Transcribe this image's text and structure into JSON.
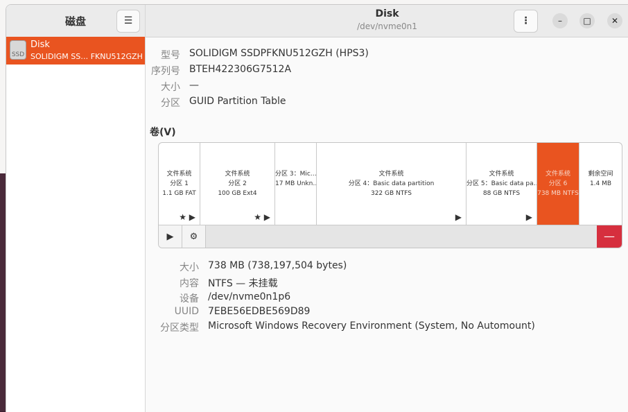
{
  "sidebar": {
    "title": "磁盘",
    "drive": {
      "icon_label": "SSD",
      "name": "Disk",
      "desc": "SOLIDIGM SS… FKNU512GZH"
    }
  },
  "header": {
    "title": "Disk",
    "subtitle": "/dev/nvme0n1",
    "menu_glyph": "⋮",
    "sidebar_menu_glyph": "☰",
    "min_glyph": "–",
    "max_glyph": "□",
    "close_glyph": "✕"
  },
  "disk_info": [
    {
      "label": "型号",
      "value": "SOLIDIGM SSDPFKNU512GZH (HPS3)"
    },
    {
      "label": "序列号",
      "value": "BTEH422306G7512A"
    },
    {
      "label": "大小",
      "value": "—"
    },
    {
      "label": "分区",
      "value": "GUID Partition Table"
    }
  ],
  "volumes_title": "卷(V)",
  "partitions": [
    {
      "l1": "文件系统",
      "l2": "分区 1",
      "l3": "1.1 GB FAT",
      "icons": "★ ▶"
    },
    {
      "l1": "文件系统",
      "l2": "分区 2",
      "l3": "100 GB Ext4",
      "icons": "★ ▶"
    },
    {
      "l1": "",
      "l2": "分区 3：Mic…",
      "l3": "17 MB Unkn…",
      "icons": ""
    },
    {
      "l1": "文件系统",
      "l2": "分区 4：Basic data partition",
      "l3": "322 GB NTFS",
      "icons": "▶"
    },
    {
      "l1": "文件系统",
      "l2": "分区 5：Basic data pa…",
      "l3": "88 GB NTFS",
      "icons": "▶"
    },
    {
      "l1": "文件系统",
      "l2": "分区 6",
      "l3": "738 MB NTFS",
      "icons": ""
    },
    {
      "l1": "",
      "l2": "剩余空间",
      "l3": "1.4 MB",
      "icons": ""
    }
  ],
  "toolbar": {
    "mount_glyph": "▶",
    "settings_glyph": "⚙",
    "delete_glyph": "—"
  },
  "selected_partition": [
    {
      "label": "大小",
      "value": "738 MB (738,197,504 bytes)"
    },
    {
      "label": "内容",
      "value": "NTFS — 未挂载"
    },
    {
      "label": "设备",
      "value": "/dev/nvme0n1p6"
    },
    {
      "label": "UUID",
      "value": "7EBE56EDBE569D89"
    },
    {
      "label": "分区类型",
      "value": "Microsoft Windows Recovery Environment (System, No Automount)"
    }
  ],
  "colors": {
    "accent": "#e95420",
    "delete": "#d62f3e"
  }
}
